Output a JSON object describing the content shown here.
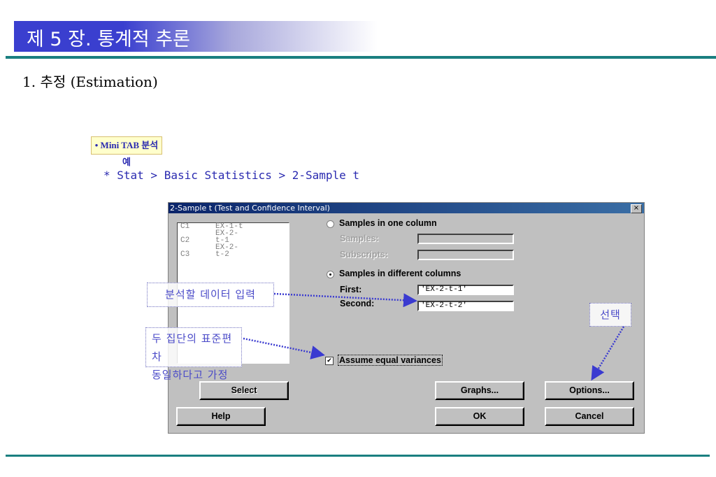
{
  "slide": {
    "title": "제 5 장. 통계적 추론",
    "subtitle": "1. 추정 (Estimation)",
    "mini_label": "• Mini TAB 분석 예",
    "menu_path": "* Stat > Basic Statistics > 2-Sample t"
  },
  "dialog": {
    "title": "2-Sample t (Test and Confidence Interval)",
    "close": "×",
    "columns": [
      {
        "id": "C1",
        "name": "EX-1-t"
      },
      {
        "id": "C2",
        "name": "EX-2-t-1"
      },
      {
        "id": "C3",
        "name": "EX-2-t-2"
      }
    ],
    "one_column": "Samples in one column",
    "samples_label": "Samples:",
    "subscripts_label": "Subscripts:",
    "diff_columns": "Samples in different columns",
    "first_label": "First:",
    "first_value": "'EX-2-t-1'",
    "second_label": "Second:",
    "second_value": "'EX-2-t-2'",
    "equal_var": "Assume equal variances",
    "equal_var_checked": true,
    "check_mark": "✔",
    "buttons": {
      "select": "Select",
      "help": "Help",
      "graphs": "Graphs...",
      "ok": "OK",
      "options": "Options...",
      "cancel": "Cancel"
    }
  },
  "annotations": {
    "input_data": "분석할 데이터 입력",
    "equal_sd_1": "두 집단의 표준편차",
    "equal_sd_2": "동일하다고 가정",
    "select": "선택"
  }
}
